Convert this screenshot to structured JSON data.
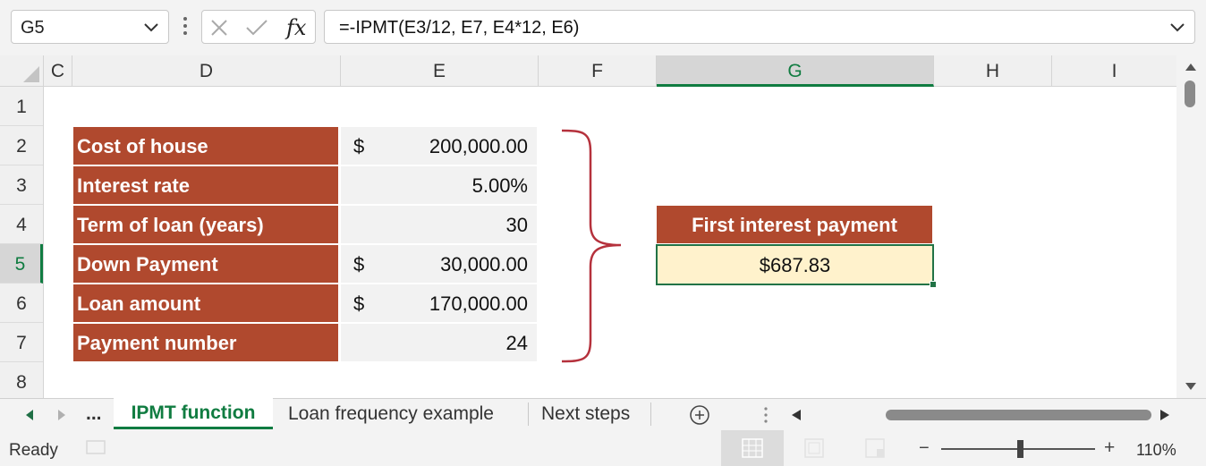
{
  "formula_bar": {
    "name_box": "G5",
    "formula": "=-IPMT(E3/12, E7, E4*12, E6)"
  },
  "columns": [
    {
      "label": "C"
    },
    {
      "label": "D"
    },
    {
      "label": "E"
    },
    {
      "label": "F"
    },
    {
      "label": "G"
    },
    {
      "label": "H"
    },
    {
      "label": "I"
    }
  ],
  "rows": [
    "1",
    "2",
    "3",
    "4",
    "5",
    "6",
    "7",
    "8"
  ],
  "table": [
    {
      "label": "Cost of house",
      "currency": "$",
      "value": "200,000.00"
    },
    {
      "label": "Interest rate",
      "currency": "",
      "value": "5.00%"
    },
    {
      "label": "Term of loan (years)",
      "currency": "",
      "value": "30"
    },
    {
      "label": "Down Payment",
      "currency": "$",
      "value": "30,000.00"
    },
    {
      "label": "Loan amount",
      "currency": "$",
      "value": "170,000.00"
    },
    {
      "label": "Payment number",
      "currency": "",
      "value": "24"
    }
  ],
  "result": {
    "header": "First interest payment",
    "value": "$687.83"
  },
  "tabs": {
    "ellipsis": "...",
    "active": "IPMT function",
    "others": [
      "Loan frequency example",
      "Next steps"
    ]
  },
  "status": {
    "text": "Ready",
    "zoom": "110%",
    "zoom_minus": "−",
    "zoom_plus": "+"
  },
  "colors": {
    "label_fill": "#b0492e",
    "result_fill": "#fff2cc",
    "accent": "#107c41",
    "brace": "#b5313c"
  }
}
